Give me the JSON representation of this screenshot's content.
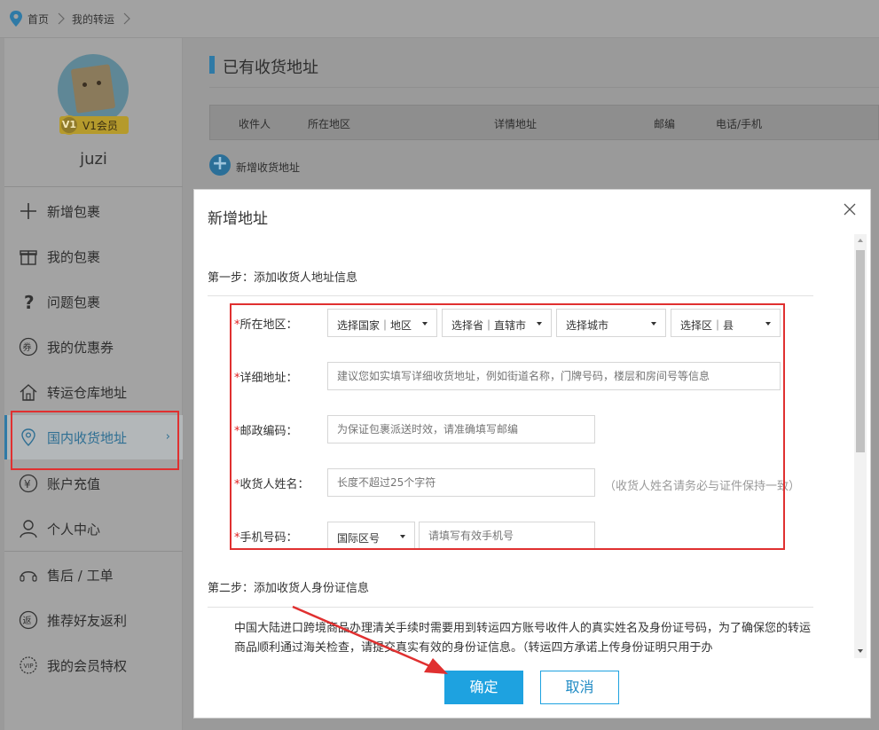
{
  "breadcrumb": {
    "home": "首页",
    "current": "我的转运"
  },
  "user": {
    "name": "juzi",
    "vip_level": "V1",
    "vip_label": "V1会员"
  },
  "sidebar": {
    "items": [
      {
        "label": "新增包裹",
        "icon": "plus-icon"
      },
      {
        "label": "我的包裹",
        "icon": "gift-icon"
      },
      {
        "label": "问题包裹",
        "icon": "question-icon"
      },
      {
        "label": "我的优惠券",
        "icon": "coupon-icon"
      },
      {
        "label": "转运仓库地址",
        "icon": "house-icon"
      },
      {
        "label": "国内收货地址",
        "icon": "location-pin-icon",
        "active": true
      },
      {
        "label": "账户充值",
        "icon": "yen-icon"
      },
      {
        "label": "个人中心",
        "icon": "user-icon"
      },
      {
        "label": "售后 / 工单",
        "icon": "headset-icon"
      },
      {
        "label": "推荐好友返利",
        "icon": "rebate-icon"
      },
      {
        "label": "我的会员特权",
        "icon": "vip-icon"
      }
    ],
    "active_arrow": "›"
  },
  "main": {
    "title": "已有收货地址",
    "table_headers": [
      "收件人",
      "所在地区",
      "详情地址",
      "邮编",
      "电话/手机"
    ],
    "add_address": "新增收货地址"
  },
  "modal": {
    "title": "新增地址",
    "step1": "第一步：添加收货人地址信息",
    "step2": "第二步：添加收货人身份证信息",
    "fields": {
      "region_label": "所在地区：",
      "region_selects": [
        "选择国家｜地区",
        "选择省｜直辖市",
        "选择城市",
        "选择区｜县"
      ],
      "address_label": "详细地址：",
      "address_placeholder": "建议您如实填写详细收货地址，例如街道名称，门牌号码，楼层和房间号等信息",
      "zip_label": "邮政编码：",
      "zip_placeholder": "为保证包裹派送时效，请准确填写邮编",
      "name_label": "收货人姓名：",
      "name_placeholder": "长度不超过25个字符",
      "name_hint": "（收货人姓名请务必与证件保持一致）",
      "phone_label": "手机号码：",
      "phone_code": "国际区号",
      "phone_placeholder": "请填写有效手机号"
    },
    "required_mark": "*",
    "paragraph": "中国大陆进口跨境商品办理清关手续时需要用到转运四方账号收件人的真实姓名及身份证号码，为了确保您的转运商品顺利通过海关检查，请提交真实有效的身份证信息。（转运四方承诺上传身份证明只用于办",
    "ok_label": "确定",
    "cancel_label": "取消"
  },
  "colors": {
    "accent": "#1ea2e0",
    "annotation_red": "#e03030",
    "required_red": "#e02020"
  }
}
